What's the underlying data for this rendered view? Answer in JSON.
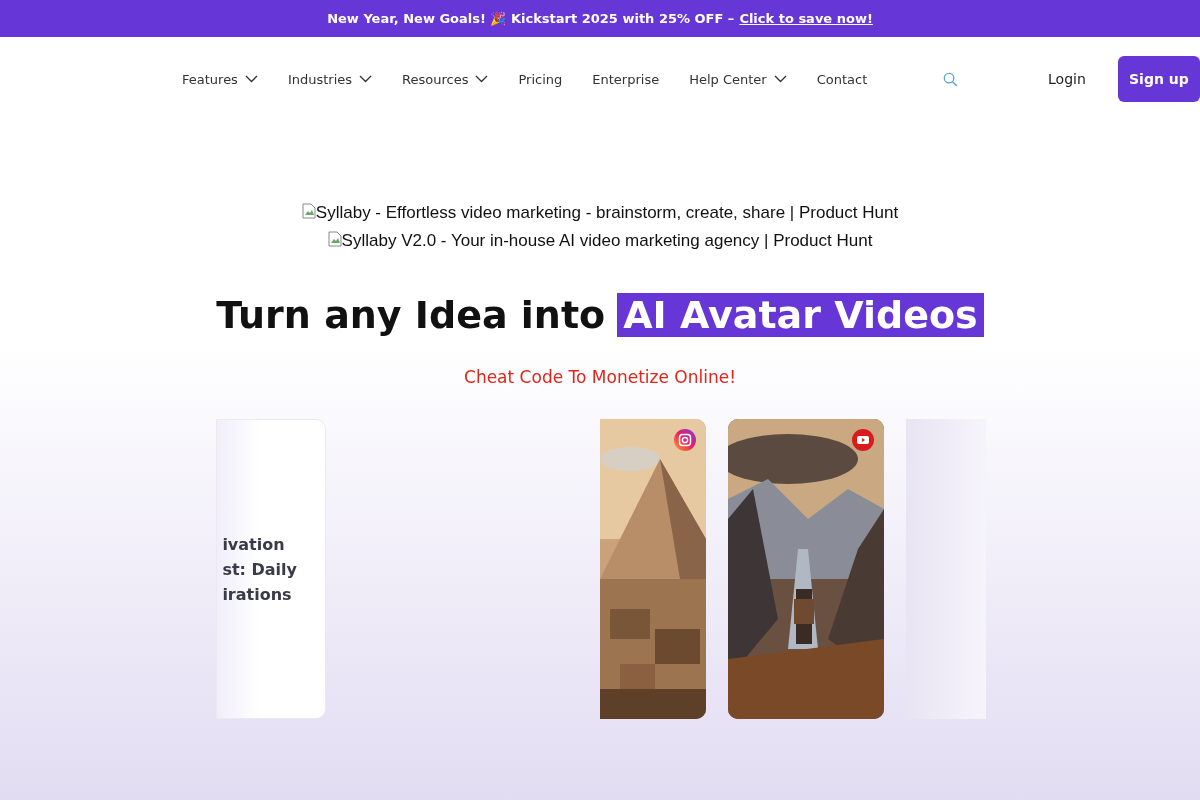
{
  "promo_bar": {
    "text": "New Year, New Goals! 🎉 Kickstart 2025 with 25% OFF –",
    "link": "Click to save now!"
  },
  "nav": {
    "items": [
      {
        "label": "Features",
        "dropdown": true
      },
      {
        "label": "Industries",
        "dropdown": true
      },
      {
        "label": "Resources",
        "dropdown": true
      },
      {
        "label": "Pricing",
        "dropdown": false
      },
      {
        "label": "Enterprise",
        "dropdown": false
      },
      {
        "label": "Help Center",
        "dropdown": true
      },
      {
        "label": "Contact",
        "dropdown": false
      }
    ],
    "login": "Login",
    "signup": "Sign up"
  },
  "badges": [
    "Syllaby - Effortless video marketing - brainstorm, create, share | Product Hunt",
    "Syllaby V2.0 - Your in-house AI video marketing agency | Product Hunt"
  ],
  "hero": {
    "title": "Turn any Idea into",
    "highlight": "AI Avatar Videos",
    "subtitle": "Cheat Code To Monetize Online!"
  },
  "carousel": [
    {
      "kind": "text",
      "lines": [
        "ivation",
        "st: Daily",
        "irations"
      ]
    },
    {
      "kind": "spacer"
    },
    {
      "kind": "pyramid"
    },
    {
      "kind": "mountain"
    },
    {
      "kind": "blank"
    }
  ]
}
